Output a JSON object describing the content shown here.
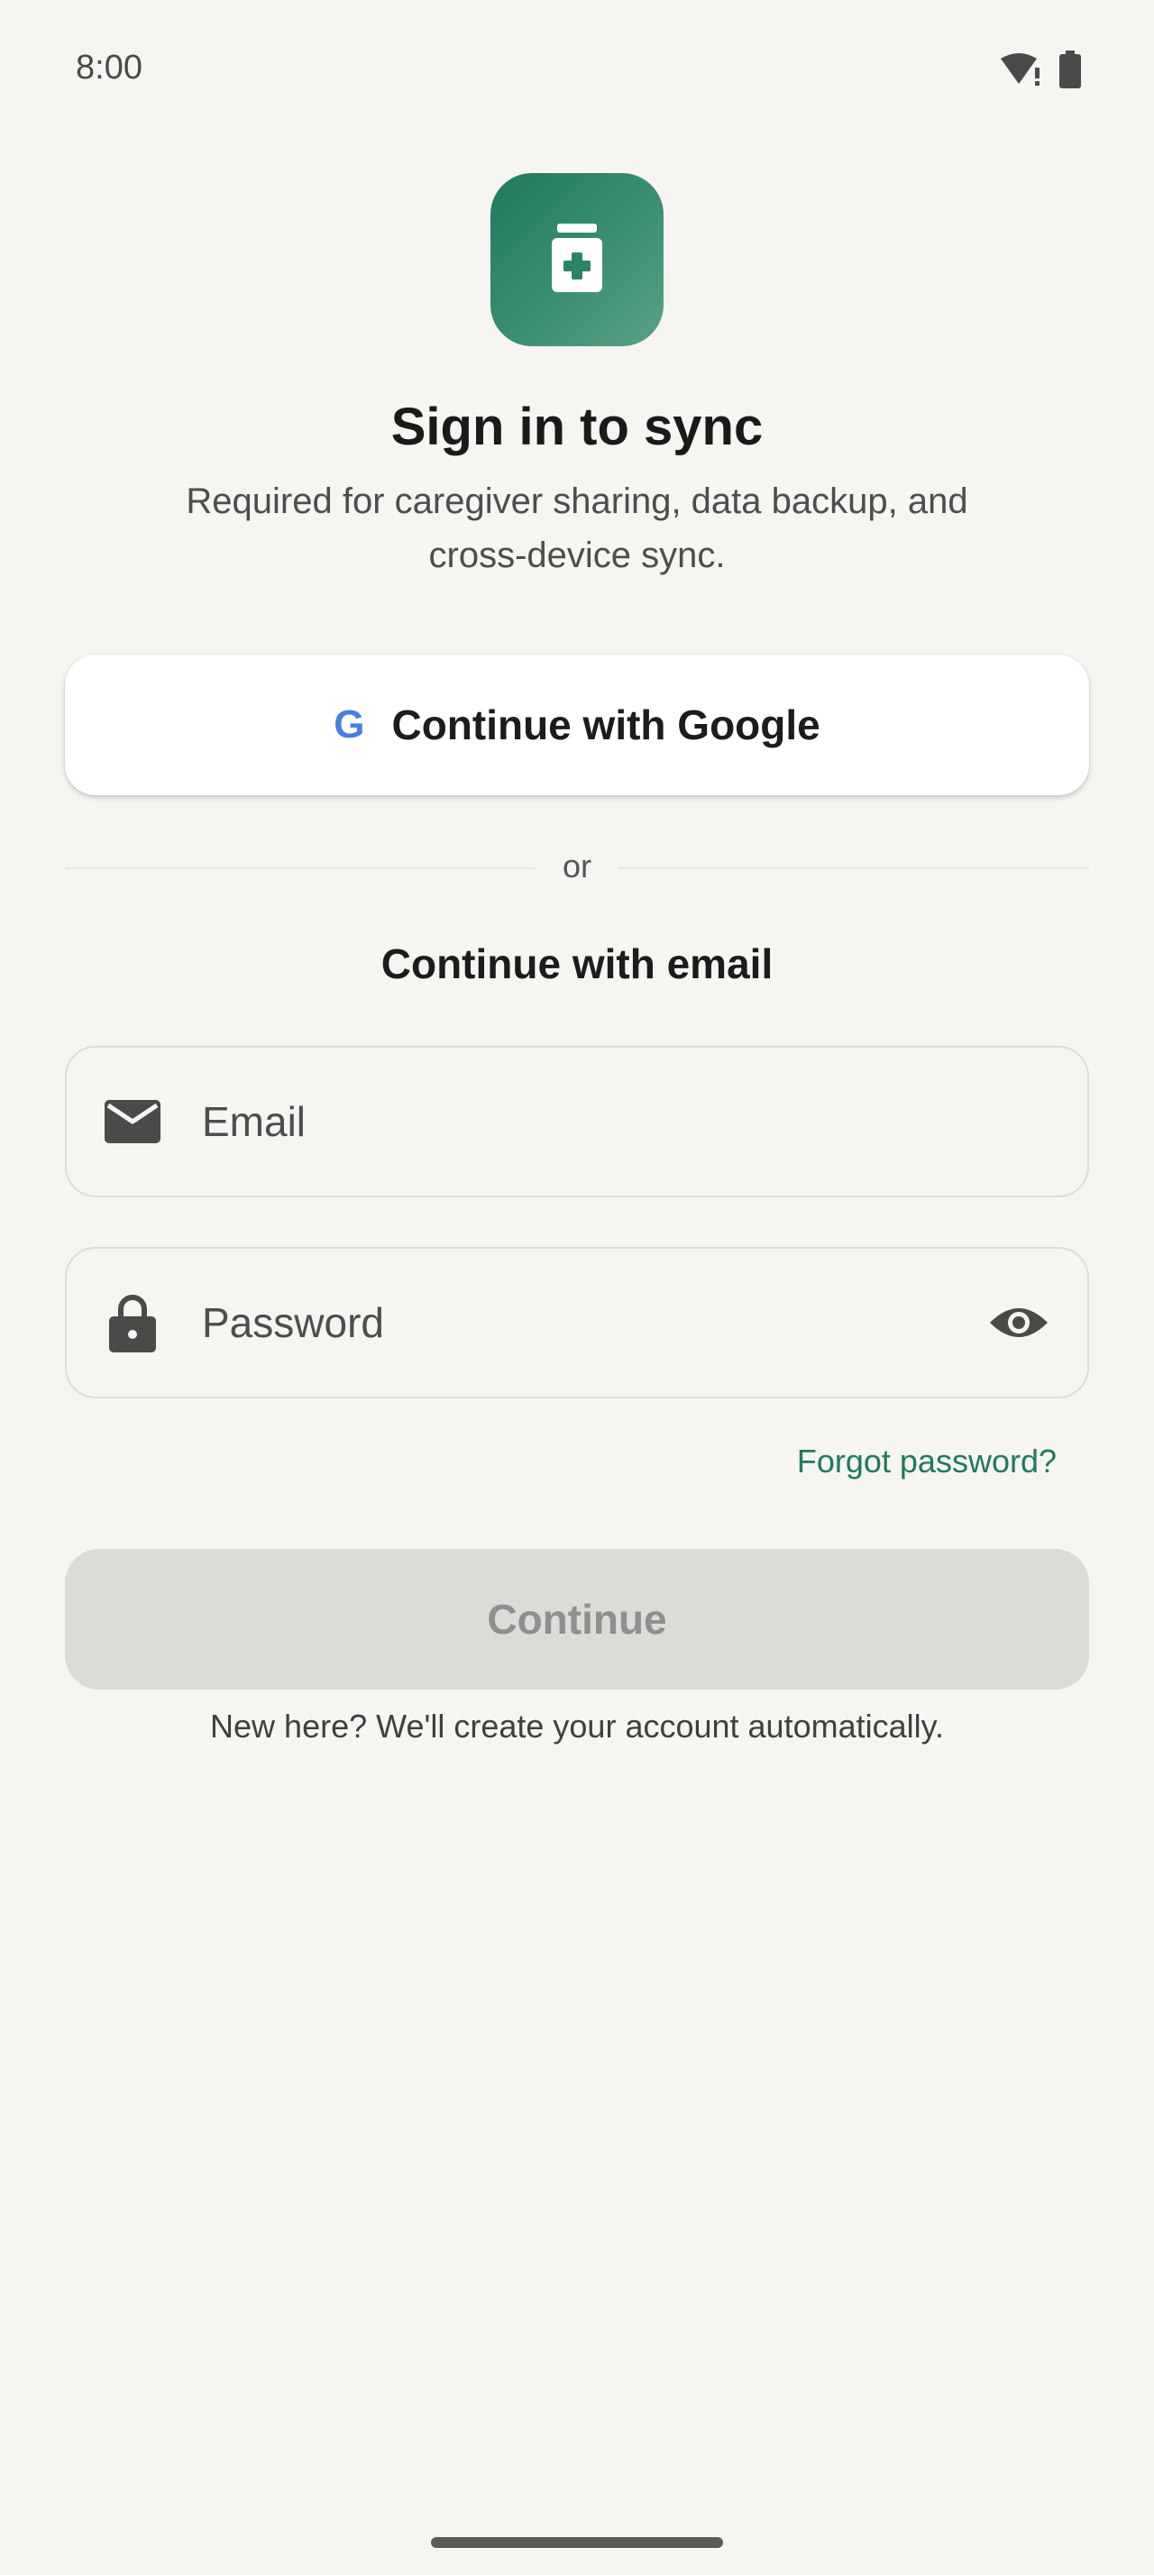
{
  "status_bar": {
    "time": "8:00",
    "icons": [
      "wifi-alert-icon",
      "battery-icon"
    ]
  },
  "app_icon": {
    "name": "medicine-bottle-icon",
    "color": "#1f7a5c"
  },
  "header": {
    "title": "Sign in to sync",
    "subtitle": "Required for caregiver sharing, data backup, and cross-device sync."
  },
  "google_button": {
    "glyph": "G",
    "label": "Continue with Google"
  },
  "divider": {
    "label": "or"
  },
  "email_section": {
    "heading": "Continue with email",
    "email_field": {
      "placeholder": "Email",
      "value": "",
      "icon": "mail-icon"
    },
    "password_field": {
      "placeholder": "Password",
      "value": "",
      "icon": "lock-icon",
      "toggle_icon": "eye-icon"
    },
    "forgot_link": "Forgot password?",
    "continue_label": "Continue",
    "continue_enabled": false,
    "footnote": "New here? We'll create your account automatically."
  },
  "colors": {
    "accent": "#1f7a5c",
    "background": "#f6f5f2",
    "disabled_button": "#dcdbd8",
    "google_blue": "#4a7fe0"
  }
}
